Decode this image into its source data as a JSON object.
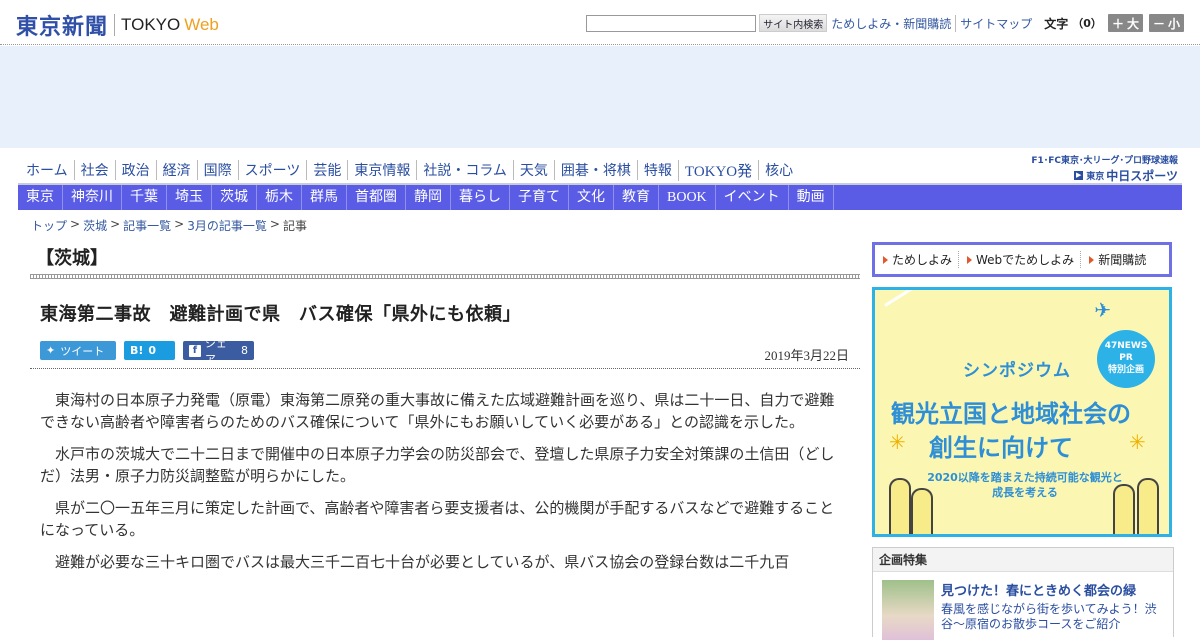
{
  "header": {
    "logo_jp": "東京新聞",
    "logo_en": "TOKYO",
    "logo_web": "Web",
    "search_button": "サイト内検索",
    "links": [
      "ためしよみ・新聞購読",
      "サイトマップ"
    ],
    "font_size_label": "文字",
    "font_size_value": "（0）",
    "font_larger": "大",
    "font_smaller": "小"
  },
  "nav_primary": [
    "ホーム",
    "社会",
    "政治",
    "経済",
    "国際",
    "スポーツ",
    "芸能",
    "東京情報",
    "社説・コラム",
    "天気",
    "囲碁・将棋",
    "特報",
    "TOKYO発",
    "核心"
  ],
  "chunichi_link": {
    "top": "F1･FC東京･大リーグ･プロ野球速報",
    "sub": "東京",
    "name": "中日スポーツ"
  },
  "nav_secondary": [
    "東京",
    "神奈川",
    "千葉",
    "埼玉",
    "茨城",
    "栃木",
    "群馬",
    "首都圏",
    "静岡",
    "暮らし",
    "子育て",
    "文化",
    "教育",
    "BOOK",
    "イベント",
    "動画"
  ],
  "breadcrumb": [
    "トップ",
    "茨城",
    "記事一覧",
    "3月の記事一覧"
  ],
  "breadcrumb_current": "記事",
  "section_title": "【茨城】",
  "article": {
    "headline": "東海第二事故　避難計画で県　バス確保「県外にも依頼」",
    "date": "2019年3月22日",
    "paragraphs": [
      "東海村の日本原子力発電（原電）東海第二原発の重大事故に備えた広域避難計画を巡り、県は二十一日、自力で避難できない高齢者や障害者らのためのバス確保について「県外にもお願いしていく必要がある」との認識を示した。",
      "水戸市の茨城大で二十二日まで開催中の日本原子力学会の防災部会で、登壇した県原子力安全対策課の土信田（どしだ）法男・原子力防災調整監が明らかにした。",
      "県が二〇一五年三月に策定した計画で、高齢者や障害者ら要支援者は、公的機関が手配するバスなどで避難することになっている。",
      "避難が必要な三十キロ圏でバスは最大三千二百七十台が必要としているが、県バス協会の登録台数は二千九百"
    ]
  },
  "share": {
    "tweet": "ツイート",
    "hatena_icon": "B!",
    "hatena_count": "0",
    "facebook_icon": "f",
    "facebook_label": "シェア",
    "facebook_count": "8"
  },
  "subscribe": [
    "ためしよみ",
    "Webでためしよみ",
    "新聞購読"
  ],
  "banner": {
    "badge": [
      "47NEWS",
      "PR",
      "特別企画"
    ],
    "symposium": "シンポジウム",
    "title_line1": "観光立国と地域社会の",
    "title_line2": "創生に向けて",
    "subtitle": "2020以降を踏まえた持続可能な観光と成長を考える"
  },
  "feature": {
    "heading": "企画特集",
    "title": "見つけた！春にときめく都会の緑",
    "text": "春風を感じながら街を歩いてみよう！渋谷～原宿のお散歩コースをご紹介"
  },
  "colors": {
    "brand_blue": "#3050a8",
    "nav_purple": "#5a5ce6",
    "web_orange": "#f0a020",
    "banner_blue": "#2cb2e6",
    "banner_yellow": "#fbf7b3"
  }
}
